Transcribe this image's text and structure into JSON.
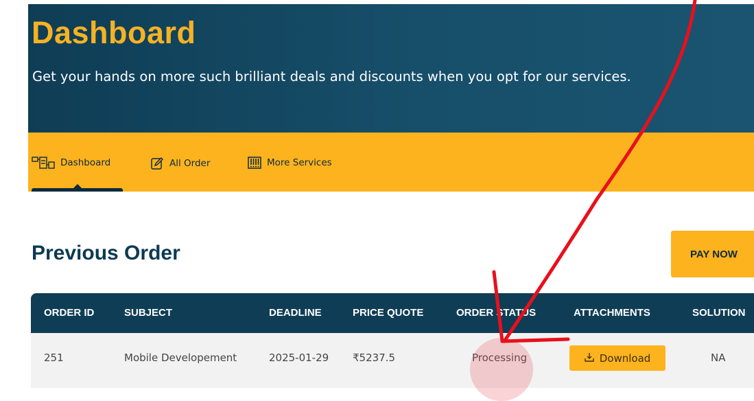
{
  "hero": {
    "title": "Dashboard",
    "subtitle": "Get your hands on more such brilliant deals and discounts when you opt for our services."
  },
  "tabs": [
    {
      "label": "Dashboard",
      "icon": "dashboard-icon",
      "active": true
    },
    {
      "label": "All Order",
      "icon": "edit-icon",
      "active": false
    },
    {
      "label": "More Services",
      "icon": "services-icon",
      "active": false
    }
  ],
  "orders": {
    "title": "Previous Order",
    "pay_label": "PAY NOW",
    "columns": [
      "ORDER ID",
      "SUBJECT",
      "DEADLINE",
      "PRICE QUOTE",
      "ORDER STATUS",
      "ATTACHMENTS",
      "SOLUTION"
    ],
    "rows": [
      {
        "order_id": "251",
        "subject": "Mobile Developement",
        "deadline": "2025-01-29",
        "price": "₹5237.5",
        "status": "Processing",
        "attachment_label": "Download",
        "solution": "NA"
      }
    ]
  },
  "colors": {
    "primary_dark": "#0f3d55",
    "accent": "#fdb31e",
    "annotation": "#e8101c"
  }
}
